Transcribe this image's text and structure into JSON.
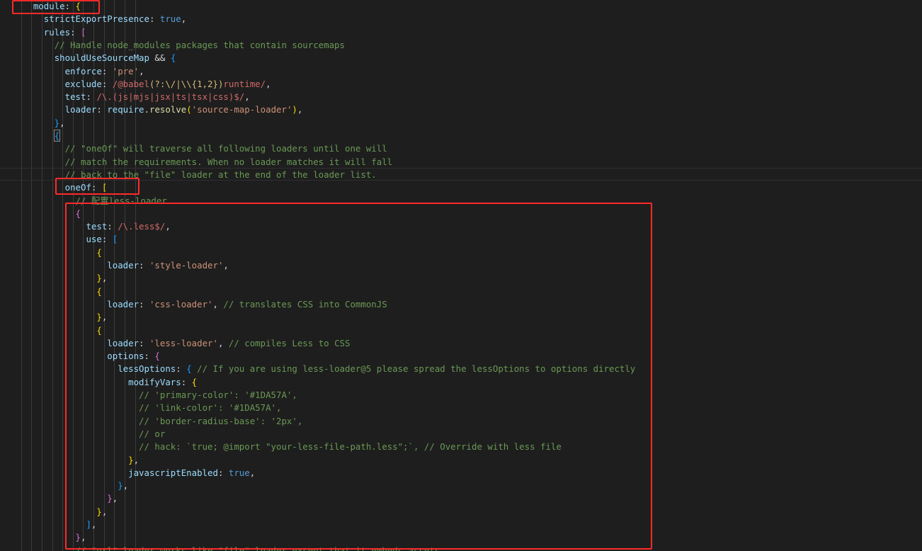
{
  "editor": {
    "language": "javascript",
    "lines": [
      [
        [
          "    ",
          "t-punc"
        ],
        [
          "module",
          "t-prop"
        ],
        [
          ": ",
          "t-punc"
        ],
        [
          "{",
          "t-b1"
        ]
      ],
      [
        [
          "      ",
          "t-punc"
        ],
        [
          "strictExportPresence",
          "t-prop"
        ],
        [
          ": ",
          "t-punc"
        ],
        [
          "true",
          "t-kw"
        ],
        [
          ",",
          "t-punc"
        ]
      ],
      [
        [
          "      ",
          "t-punc"
        ],
        [
          "rules",
          "t-prop"
        ],
        [
          ": ",
          "t-punc"
        ],
        [
          "[",
          "t-b2"
        ]
      ],
      [
        [
          "        ",
          "t-punc"
        ],
        [
          "// Handle node_modules packages that contain sourcemaps",
          "t-com"
        ]
      ],
      [
        [
          "        ",
          "t-punc"
        ],
        [
          "shouldUseSourceMap",
          "t-prop"
        ],
        [
          " && ",
          "t-punc"
        ],
        [
          "{",
          "t-b3"
        ]
      ],
      [
        [
          "          ",
          "t-punc"
        ],
        [
          "enforce",
          "t-prop"
        ],
        [
          ": ",
          "t-punc"
        ],
        [
          "'pre'",
          "t-str"
        ],
        [
          ",",
          "t-punc"
        ]
      ],
      [
        [
          "          ",
          "t-punc"
        ],
        [
          "exclude",
          "t-prop"
        ],
        [
          ": ",
          "t-punc"
        ],
        [
          "/@babel",
          "t-rx"
        ],
        [
          "(?:\\/|\\\\{1,2})",
          "t-rxc"
        ],
        [
          "runtime/",
          "t-rx"
        ],
        [
          ",",
          "t-punc"
        ]
      ],
      [
        [
          "          ",
          "t-punc"
        ],
        [
          "test",
          "t-prop"
        ],
        [
          ": ",
          "t-punc"
        ],
        [
          "/\\.(js|mjs|jsx|ts|tsx|css)$/",
          "t-rx"
        ],
        [
          ",",
          "t-punc"
        ]
      ],
      [
        [
          "          ",
          "t-punc"
        ],
        [
          "loader",
          "t-prop"
        ],
        [
          ": ",
          "t-punc"
        ],
        [
          "require",
          "t-prop"
        ],
        [
          ".",
          "t-punc"
        ],
        [
          "resolve",
          "t-fn"
        ],
        [
          "(",
          "t-b1"
        ],
        [
          "'source-map-loader'",
          "t-str"
        ],
        [
          ")",
          "t-b1"
        ],
        [
          ",",
          "t-punc"
        ]
      ],
      [
        [
          "        ",
          "t-punc"
        ],
        [
          "}",
          "t-b3"
        ],
        [
          ",",
          "t-punc"
        ]
      ],
      [
        [
          "        ",
          "t-punc"
        ],
        [
          "{",
          "t-b3 t-brm"
        ]
      ],
      [
        [
          "          ",
          "t-punc"
        ],
        [
          "// \"oneOf\" will traverse all following loaders until one will",
          "t-com"
        ]
      ],
      [
        [
          "          ",
          "t-punc"
        ],
        [
          "// match the requirements. When no loader matches it will fall",
          "t-com"
        ]
      ],
      [
        [
          "          ",
          "t-punc"
        ],
        [
          "// back to the \"file\" loader at the end of the loader list.",
          "t-com"
        ]
      ],
      [
        [
          "          ",
          "t-punc"
        ],
        [
          "oneOf",
          "t-prop"
        ],
        [
          ": ",
          "t-punc"
        ],
        [
          "[",
          "t-b1"
        ]
      ],
      [
        [
          "            ",
          "t-punc"
        ],
        [
          "// 配置less-loader",
          "t-com"
        ]
      ],
      [
        [
          "            ",
          "t-punc"
        ],
        [
          "{",
          "t-b2"
        ]
      ],
      [
        [
          "              ",
          "t-punc"
        ],
        [
          "test",
          "t-prop"
        ],
        [
          ": ",
          "t-punc"
        ],
        [
          "/\\.less$/",
          "t-rx"
        ],
        [
          ",",
          "t-punc"
        ]
      ],
      [
        [
          "              ",
          "t-punc"
        ],
        [
          "use",
          "t-prop"
        ],
        [
          ": ",
          "t-punc"
        ],
        [
          "[",
          "t-b3"
        ]
      ],
      [
        [
          "                ",
          "t-punc"
        ],
        [
          "{",
          "t-b1"
        ]
      ],
      [
        [
          "                  ",
          "t-punc"
        ],
        [
          "loader",
          "t-prop"
        ],
        [
          ": ",
          "t-punc"
        ],
        [
          "'style-loader'",
          "t-str"
        ],
        [
          ",",
          "t-punc"
        ]
      ],
      [
        [
          "                ",
          "t-punc"
        ],
        [
          "}",
          "t-b1"
        ],
        [
          ",",
          "t-punc"
        ]
      ],
      [
        [
          "                ",
          "t-punc"
        ],
        [
          "{",
          "t-b1"
        ]
      ],
      [
        [
          "                  ",
          "t-punc"
        ],
        [
          "loader",
          "t-prop"
        ],
        [
          ": ",
          "t-punc"
        ],
        [
          "'css-loader'",
          "t-str"
        ],
        [
          ", ",
          "t-punc"
        ],
        [
          "// translates CSS into CommonJS",
          "t-com"
        ]
      ],
      [
        [
          "                ",
          "t-punc"
        ],
        [
          "}",
          "t-b1"
        ],
        [
          ",",
          "t-punc"
        ]
      ],
      [
        [
          "                ",
          "t-punc"
        ],
        [
          "{",
          "t-b1"
        ]
      ],
      [
        [
          "                  ",
          "t-punc"
        ],
        [
          "loader",
          "t-prop"
        ],
        [
          ": ",
          "t-punc"
        ],
        [
          "'less-loader'",
          "t-str"
        ],
        [
          ", ",
          "t-punc"
        ],
        [
          "// compiles Less to CSS",
          "t-com"
        ]
      ],
      [
        [
          "                  ",
          "t-punc"
        ],
        [
          "options",
          "t-prop"
        ],
        [
          ": ",
          "t-punc"
        ],
        [
          "{",
          "t-b2"
        ]
      ],
      [
        [
          "                    ",
          "t-punc"
        ],
        [
          "lessOptions",
          "t-prop"
        ],
        [
          ": ",
          "t-punc"
        ],
        [
          "{",
          "t-b3"
        ],
        [
          " ",
          "t-punc"
        ],
        [
          "// If you are using less-loader@5 please spread the lessOptions to options directly",
          "t-com"
        ]
      ],
      [
        [
          "                      ",
          "t-punc"
        ],
        [
          "modifyVars",
          "t-prop"
        ],
        [
          ": ",
          "t-punc"
        ],
        [
          "{",
          "t-b1"
        ]
      ],
      [
        [
          "                        ",
          "t-punc"
        ],
        [
          "// 'primary-color': '#1DA57A',",
          "t-com"
        ]
      ],
      [
        [
          "                        ",
          "t-punc"
        ],
        [
          "// 'link-color': '#1DA57A',",
          "t-com"
        ]
      ],
      [
        [
          "                        ",
          "t-punc"
        ],
        [
          "// 'border-radius-base': '2px',",
          "t-com"
        ]
      ],
      [
        [
          "                        ",
          "t-punc"
        ],
        [
          "// or",
          "t-com"
        ]
      ],
      [
        [
          "                        ",
          "t-punc"
        ],
        [
          "// hack: `true; @import \"your-less-file-path.less\";`, // Override with less file",
          "t-com"
        ]
      ],
      [
        [
          "                      ",
          "t-punc"
        ],
        [
          "}",
          "t-b1"
        ],
        [
          ",",
          "t-punc"
        ]
      ],
      [
        [
          "                      ",
          "t-punc"
        ],
        [
          "javascriptEnabled",
          "t-prop"
        ],
        [
          ": ",
          "t-punc"
        ],
        [
          "true",
          "t-kw"
        ],
        [
          ",",
          "t-punc"
        ]
      ],
      [
        [
          "                    ",
          "t-punc"
        ],
        [
          "}",
          "t-b3"
        ],
        [
          ",",
          "t-punc"
        ]
      ],
      [
        [
          "                  ",
          "t-punc"
        ],
        [
          "}",
          "t-b2"
        ],
        [
          ",",
          "t-punc"
        ]
      ],
      [
        [
          "                ",
          "t-punc"
        ],
        [
          "}",
          "t-b1"
        ],
        [
          ",",
          "t-punc"
        ]
      ],
      [
        [
          "              ",
          "t-punc"
        ],
        [
          "]",
          "t-b3"
        ],
        [
          ",",
          "t-punc"
        ]
      ],
      [
        [
          "            ",
          "t-punc"
        ],
        [
          "}",
          "t-b2"
        ],
        [
          ",",
          "t-punc"
        ]
      ],
      [
        [
          "            ",
          "t-punc"
        ],
        [
          "// \"url\" loader works like \"file\" loader except that it embeds assets",
          "t-com"
        ]
      ]
    ]
  },
  "annotations": {
    "color": "#ff2a2a"
  }
}
